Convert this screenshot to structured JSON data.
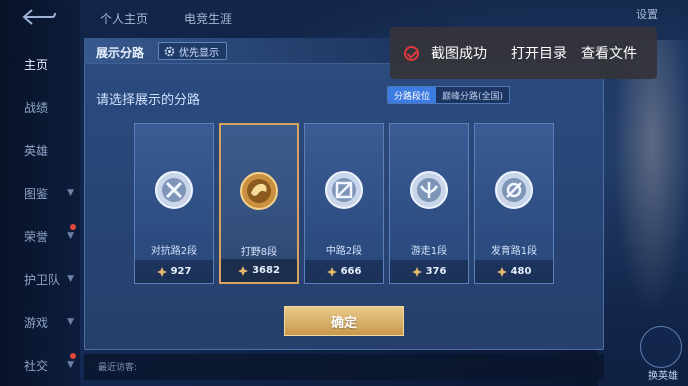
{
  "top_tabs": [
    "个人主页",
    "电竞生涯"
  ],
  "sidebar": {
    "items": [
      {
        "label": "主页",
        "active": true
      },
      {
        "label": "战绩"
      },
      {
        "label": "英雄"
      },
      {
        "label": "图鉴",
        "chevron": true
      },
      {
        "label": "荣誉",
        "chevron": true,
        "dot": true
      },
      {
        "label": "护卫队",
        "chevron": true
      },
      {
        "label": "游戏",
        "chevron": true
      },
      {
        "label": "社交",
        "chevron": true,
        "dot": true
      }
    ]
  },
  "settings_label": "设置",
  "toast": {
    "success": "截图成功",
    "open_dir": "打开目录",
    "view_file": "查看文件"
  },
  "dialog": {
    "title": "展示分路",
    "priority_label": "优先显示",
    "subtitle": "请选择展示的分路",
    "toggle": [
      "分路段位",
      "巅峰分路(全国)"
    ],
    "toggle_selected": 0,
    "cards": [
      {
        "label": "对抗路2段",
        "score": "927",
        "icon": "shield-sword-icon"
      },
      {
        "label": "打野8段",
        "score": "3682",
        "icon": "jungle-beast-icon",
        "selected": true
      },
      {
        "label": "中路2段",
        "score": "666",
        "icon": "mid-lane-icon"
      },
      {
        "label": "游走1段",
        "score": "376",
        "icon": "roam-wing-icon"
      },
      {
        "label": "发育路1段",
        "score": "480",
        "icon": "archer-target-icon"
      }
    ],
    "confirm_label": "确定"
  },
  "bottom_bar": {
    "recent_label": "最近访客:"
  },
  "change_hero_label": "换英雄",
  "colors": {
    "accent_gold": "#d8a25e",
    "toggle_on": "#3c7be0",
    "toast_icon": "#e0393c"
  }
}
